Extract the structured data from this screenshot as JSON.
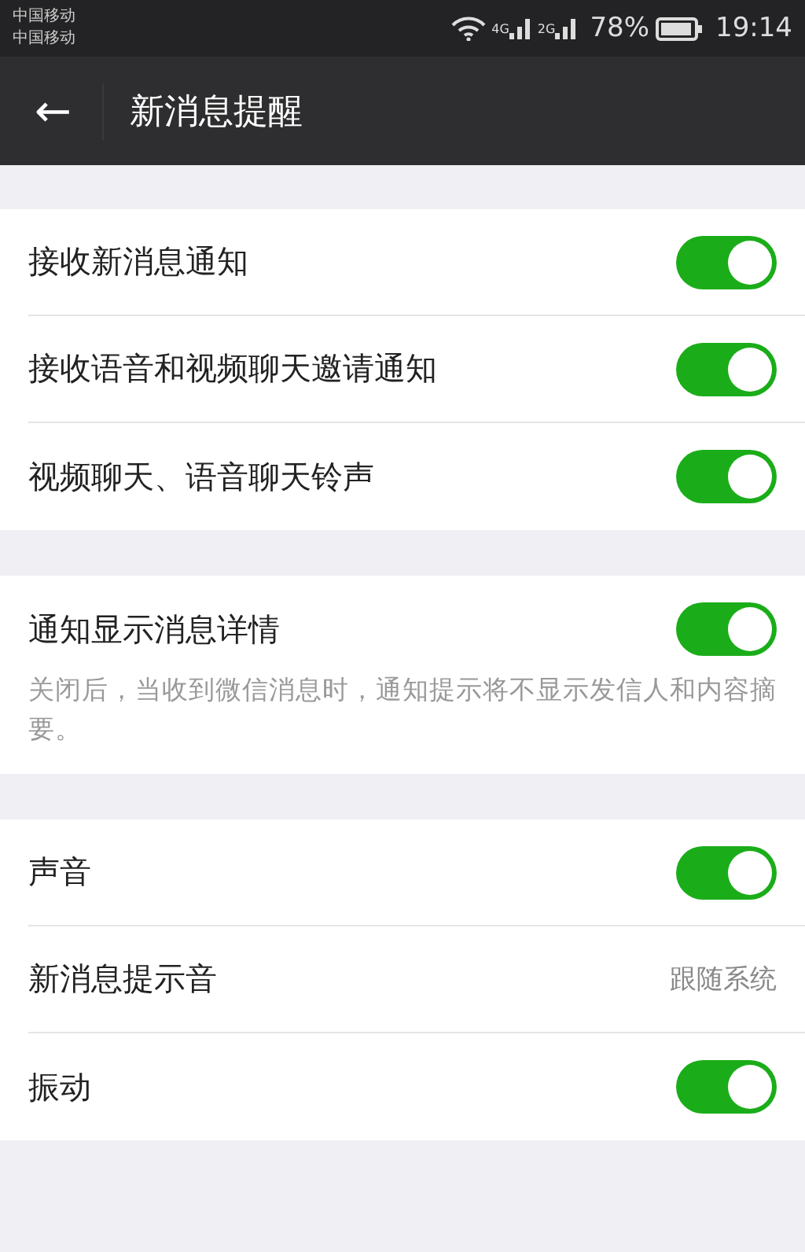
{
  "status_bar": {
    "carriers": [
      "中国移动",
      "中国移动"
    ],
    "network_1": "4G",
    "network_2": "2G",
    "battery": "78%",
    "time": "19:14"
  },
  "toolbar": {
    "back": "←",
    "title": "新消息提醒"
  },
  "groups": [
    {
      "rows": [
        {
          "kind": "switch",
          "label": "接收新消息通知",
          "on": true
        },
        {
          "kind": "switch",
          "label": "接收语音和视频聊天邀请通知",
          "on": true
        },
        {
          "kind": "switch",
          "label": "视频聊天、语音聊天铃声",
          "on": true
        }
      ]
    },
    {
      "rows": [
        {
          "kind": "switch",
          "label": "通知显示消息详情",
          "on": true
        }
      ],
      "note": "关闭后，当收到微信消息时，通知提示将不显示发信人和内容摘要。"
    },
    {
      "rows": [
        {
          "kind": "switch",
          "label": "声音",
          "on": true
        },
        {
          "kind": "value",
          "label": "新消息提示音",
          "value": "跟随系统"
        },
        {
          "kind": "switch",
          "label": "振动",
          "on": true
        }
      ]
    }
  ]
}
